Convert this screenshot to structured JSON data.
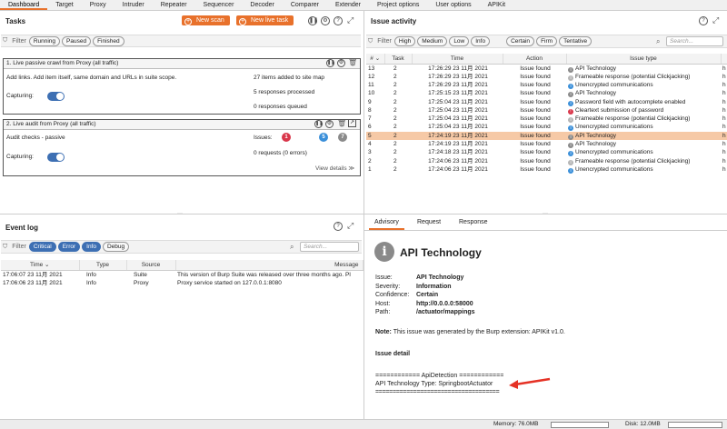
{
  "menu": [
    "Dashboard",
    "Target",
    "Proxy",
    "Intruder",
    "Repeater",
    "Sequencer",
    "Decoder",
    "Comparer",
    "Extender",
    "Project options",
    "User options",
    "APIKit"
  ],
  "tasks": {
    "title": "Tasks",
    "new_scan": "New scan",
    "new_live_task": "New live task",
    "filter_label": "Filter",
    "filters": [
      "Running",
      "Paused",
      "Finished"
    ],
    "task1": {
      "title": "1. Live passive crawl from Proxy (all traffic)",
      "desc": "Add links. Add item itself, same domain and URLs in suite scope.",
      "capturing": "Capturing:",
      "stat1": "27 items added to site map",
      "stat2": "5 responses processed",
      "stat3": "0 responses queued"
    },
    "task2": {
      "title": "2. Live audit from Proxy (all traffic)",
      "desc": "Audit checks - passive",
      "capturing": "Capturing:",
      "issues_label": "Issues:",
      "issue_high": "1",
      "issue_info": "5",
      "issue_other": "7",
      "requests": "0 requests (0 errors)",
      "view_details": "View details ≫"
    }
  },
  "issue_activity": {
    "title": "Issue activity",
    "filter_label": "Filter",
    "filters": [
      "High",
      "Medium",
      "Low",
      "Info",
      "Certain",
      "Firm",
      "Tentative"
    ],
    "search_placeholder": "Search...",
    "columns": [
      "#",
      "Task",
      "Time",
      "Action",
      "Issue type"
    ],
    "rows": [
      {
        "n": "13",
        "task": "2",
        "time": "17:26:29 23 11月 2021",
        "action": "Issue found",
        "sev": "info",
        "type": "API Technology",
        "extra": "h"
      },
      {
        "n": "12",
        "task": "2",
        "time": "17:26:29 23 11月 2021",
        "action": "Issue found",
        "sev": "gray",
        "type": "Frameable response (potential Clickjacking)",
        "extra": "h"
      },
      {
        "n": "11",
        "task": "2",
        "time": "17:26:29 23 11月 2021",
        "action": "Issue found",
        "sev": "info2",
        "type": "Unencrypted communications",
        "extra": "h"
      },
      {
        "n": "10",
        "task": "2",
        "time": "17:25:15 23 11月 2021",
        "action": "Issue found",
        "sev": "info",
        "type": "API Technology",
        "extra": "h"
      },
      {
        "n": "9",
        "task": "2",
        "time": "17:25:04 23 11月 2021",
        "action": "Issue found",
        "sev": "info2",
        "type": "Password field with autocomplete enabled",
        "extra": "h"
      },
      {
        "n": "8",
        "task": "2",
        "time": "17:25:04 23 11月 2021",
        "action": "Issue found",
        "sev": "high",
        "type": "Cleartext submission of password",
        "extra": "h"
      },
      {
        "n": "7",
        "task": "2",
        "time": "17:25:04 23 11月 2021",
        "action": "Issue found",
        "sev": "gray",
        "type": "Frameable response (potential Clickjacking)",
        "extra": "h"
      },
      {
        "n": "6",
        "task": "2",
        "time": "17:25:04 23 11月 2021",
        "action": "Issue found",
        "sev": "info2",
        "type": "Unencrypted communications",
        "extra": "h"
      },
      {
        "n": "5",
        "task": "2",
        "time": "17:24:19 23 11月 2021",
        "action": "Issue found",
        "sev": "info",
        "type": "API Technology",
        "extra": "h"
      },
      {
        "n": "4",
        "task": "2",
        "time": "17:24:19 23 11月 2021",
        "action": "Issue found",
        "sev": "info",
        "type": "API Technology",
        "extra": "h"
      },
      {
        "n": "3",
        "task": "2",
        "time": "17:24:18 23 11月 2021",
        "action": "Issue found",
        "sev": "info2",
        "type": "Unencrypted communications",
        "extra": "h"
      },
      {
        "n": "2",
        "task": "2",
        "time": "17:24:06 23 11月 2021",
        "action": "Issue found",
        "sev": "gray",
        "type": "Frameable response (potential Clickjacking)",
        "extra": "h"
      },
      {
        "n": "1",
        "task": "2",
        "time": "17:24:06 23 11月 2021",
        "action": "Issue found",
        "sev": "info2",
        "type": "Unencrypted communications",
        "extra": "h"
      }
    ],
    "highlighted_row": "5"
  },
  "event_log": {
    "title": "Event log",
    "filter_label": "Filter",
    "filters": [
      "Critical",
      "Error",
      "Info",
      "Debug"
    ],
    "search_placeholder": "Search...",
    "columns": [
      "Time",
      "Type",
      "Source",
      "Message"
    ],
    "rows": [
      {
        "time": "17:06:07 23 11月 2021",
        "type": "Info",
        "source": "Suite",
        "message": "This version of Burp Suite was released over three months ago. Pl"
      },
      {
        "time": "17:06:06 23 11月 2021",
        "type": "Info",
        "source": "Proxy",
        "message": "Proxy service started on 127.0.0.1:8080"
      }
    ]
  },
  "advisory": {
    "tabs": [
      "Advisory",
      "Request",
      "Response"
    ],
    "heading": "API Technology",
    "fields": [
      {
        "k": "Issue:",
        "v": "API Technology"
      },
      {
        "k": "Severity:",
        "v": "Information"
      },
      {
        "k": "Confidence:",
        "v": "Certain"
      },
      {
        "k": "Host:",
        "v": "http://0.0.0.0:58000"
      },
      {
        "k": "Path:",
        "v": "/actuator/mappings"
      }
    ],
    "note_label": "Note:",
    "note_text": " This issue was generated by the Burp extension: APIKit v1.0.",
    "detail_heading": "Issue detail",
    "detail_line1": "============ ApiDetection ============",
    "detail_line2": "API Technology Type: SpringbootActuator",
    "detail_line3": "===================================="
  },
  "status": {
    "memory": "Memory: 76.0MB",
    "disk": "Disk: 12.0MB"
  },
  "colors": {
    "accent": "#e8712b",
    "blue": "#3d6fb3",
    "highlight": "#f6c9a6"
  }
}
